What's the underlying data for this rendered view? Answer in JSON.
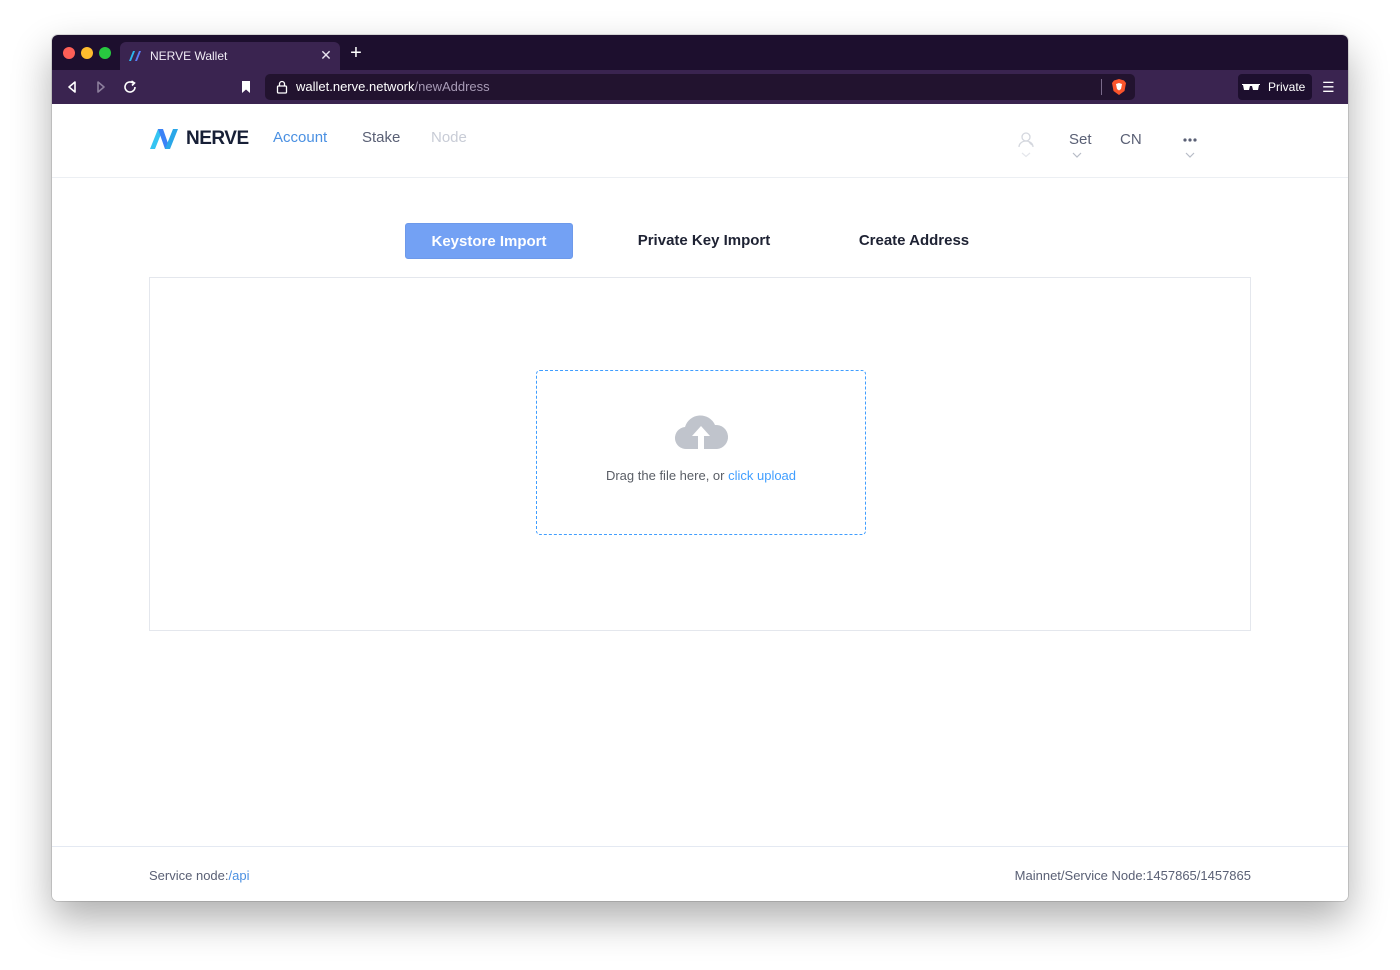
{
  "browser": {
    "tab_title": "NERVE Wallet",
    "url_host": "wallet.nerve.network",
    "url_path": "/newAddress",
    "private_label": "Private"
  },
  "header": {
    "logo_text": "NERVE",
    "nav": {
      "account": "Account",
      "stake": "Stake",
      "node": "Node"
    },
    "set_label": "Set",
    "lang_label": "CN"
  },
  "import_tabs": {
    "keystore": "Keystore Import",
    "private_key": "Private Key Import",
    "create": "Create Address"
  },
  "upload": {
    "prompt": "Drag the file here, or ",
    "link": "click upload"
  },
  "footer": {
    "service_label": "Service node:",
    "service_value": "/api",
    "status": "Mainnet/Service Node:1457865/1457865"
  },
  "colors": {
    "accent": "#4a90e2",
    "tab_active_bg": "#73a1f4",
    "chrome_dark": "#1d0f2e",
    "chrome_toolbar": "#3a2450"
  },
  "icons": [
    "back-icon",
    "forward-icon",
    "reload-icon",
    "bookmark-icon",
    "lock-icon",
    "brave-shield-icon",
    "private-glasses-icon",
    "menu-icon",
    "user-icon",
    "more-icon",
    "cloud-upload-icon"
  ]
}
